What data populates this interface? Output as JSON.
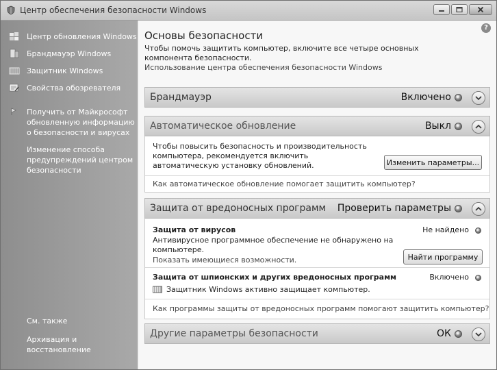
{
  "window": {
    "title": "Центр обеспечения безопасности Windows"
  },
  "sidebar": {
    "items": [
      {
        "label": "Центр обновления Windows",
        "icon": "windows-update-icon"
      },
      {
        "label": "Брандмауэр Windows",
        "icon": "firewall-icon"
      },
      {
        "label": "Защитник Windows",
        "icon": "defender-icon"
      },
      {
        "label": "Свойства обозревателя",
        "icon": "internet-options-icon"
      },
      {
        "label": "Получить от Майкрософт\nобновленную информацию\nо безопасности и вирусах",
        "icon": "globe-info-icon"
      },
      {
        "label": "Изменение способа\nпредупреждений центром\nбезопасности",
        "icon": ""
      }
    ],
    "see_also": "См. также",
    "backup": "Архивация и\nвосстановление"
  },
  "main": {
    "title": "Основы безопасности",
    "subtitle": "Чтобы помочь защитить компьютер, включите все четыре основных компонента безопасности.",
    "link": "Использование центра обеспечения безопасности Windows",
    "sections": {
      "firewall": {
        "name": "Брандмауэр",
        "status": "Включено"
      },
      "auto_update": {
        "name": "Автоматическое обновление",
        "status": "Выкл",
        "text": "Чтобы повысить безопасность и производительность компьютера, рекомендуется включить автоматическую установку обновлений.",
        "button": "Изменить параметры...",
        "help_link": "Как автоматическое обновление помогает защитить компьютер?"
      },
      "malware": {
        "name": "Защита от вредоносных программ",
        "status": "Проверить параметры",
        "virus_title": "Защита от вирусов",
        "virus_status": "Не найдено",
        "virus_text": "Антивирусное программное обеспечение не обнаружено на компьютере.",
        "virus_link": "Показать имеющиеся возможности.",
        "virus_button": "Найти программу",
        "spy_title": "Защита от шпионских и других вредоносных программ",
        "spy_status": "Включено",
        "spy_text": "Защитник Windows активно защищает компьютер.",
        "help_link": "Как программы защиты от вредоносных программ помогают защитить компьютер?"
      },
      "other": {
        "name": "Другие параметры безопасности",
        "status": "ОК"
      }
    }
  },
  "help_icon": "?"
}
